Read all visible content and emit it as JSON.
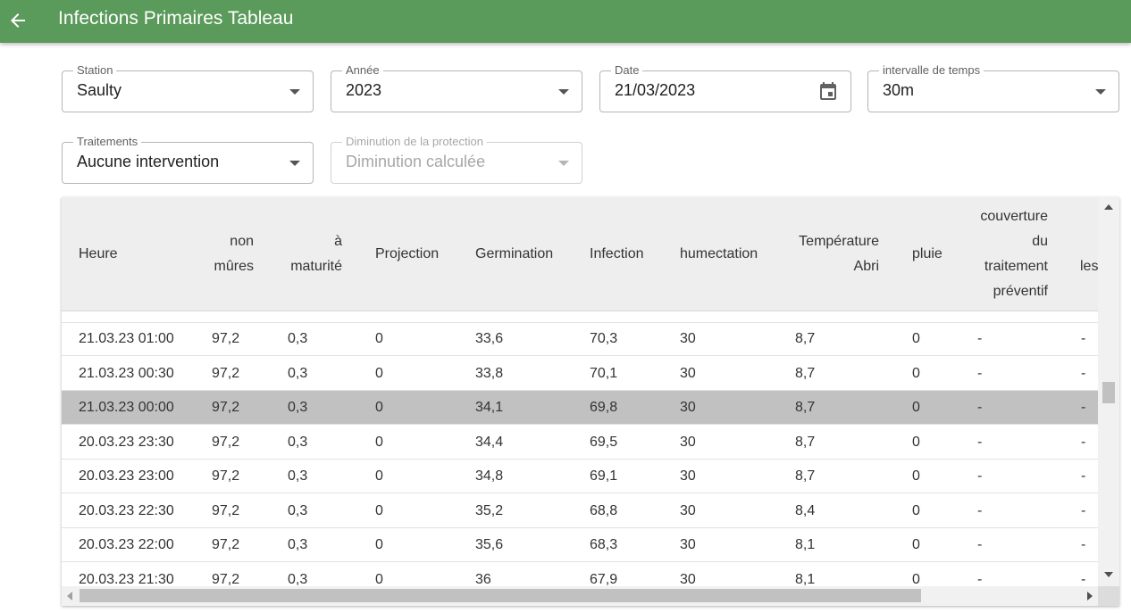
{
  "header": {
    "title": "Infections Primaires Tableau",
    "back_icon": "arrow-left-icon"
  },
  "filters": {
    "station": {
      "label": "Station",
      "value": "Saulty"
    },
    "annee": {
      "label": "Année",
      "value": "2023"
    },
    "date": {
      "label": "Date",
      "value": "21/03/2023",
      "icon": "calendar-icon"
    },
    "intervalle": {
      "label": "intervalle de temps",
      "value": "30m"
    },
    "traitements": {
      "label": "Traitements",
      "value": "Aucune intervention"
    },
    "diminution": {
      "label": "Diminution de la protection",
      "value": "Diminution calculée"
    }
  },
  "table": {
    "columns": {
      "heure": "Heure",
      "non_mures_1": "non",
      "non_mures_2": "mûres",
      "maturite_1": "à",
      "maturite_2": "maturité",
      "projection": "Projection",
      "germination": "Germination",
      "infection": "Infection",
      "humectation": "humectation",
      "temperature_1": "Température",
      "temperature_2": "Abri",
      "pluie": "pluie",
      "couverture_1": "couverture",
      "couverture_2": "du",
      "couverture_3": "traitement",
      "couverture_4": "préventif",
      "les": "les"
    },
    "rows": [
      [
        "21.03.23 01:00",
        "97,2",
        "0,3",
        "0",
        "33,6",
        "70,3",
        "30",
        "8,7",
        "0",
        "-",
        "-"
      ],
      [
        "21.03.23 00:30",
        "97,2",
        "0,3",
        "0",
        "33,8",
        "70,1",
        "30",
        "8,7",
        "0",
        "-",
        "-"
      ],
      [
        "21.03.23 00:00",
        "97,2",
        "0,3",
        "0",
        "34,1",
        "69,8",
        "30",
        "8,7",
        "0",
        "-",
        "-"
      ],
      [
        "20.03.23 23:30",
        "97,2",
        "0,3",
        "0",
        "34,4",
        "69,5",
        "30",
        "8,7",
        "0",
        "-",
        "-"
      ],
      [
        "20.03.23 23:00",
        "97,2",
        "0,3",
        "0",
        "34,8",
        "69,1",
        "30",
        "8,7",
        "0",
        "-",
        "-"
      ],
      [
        "20.03.23 22:30",
        "97,2",
        "0,3",
        "0",
        "35,2",
        "68,8",
        "30",
        "8,4",
        "0",
        "-",
        "-"
      ],
      [
        "20.03.23 22:00",
        "97,2",
        "0,3",
        "0",
        "35,6",
        "68,3",
        "30",
        "8,1",
        "0",
        "-",
        "-"
      ],
      [
        "20.03.23 21:30",
        "97,2",
        "0,3",
        "0",
        "36",
        "67,9",
        "30",
        "8,1",
        "0",
        "-",
        "-"
      ]
    ],
    "selected_row": "21.03.23 00:00"
  },
  "colors": {
    "appbar": "#5a9a5a",
    "selected_row": "#c1c1c1",
    "header_bg": "#eeeeee"
  }
}
